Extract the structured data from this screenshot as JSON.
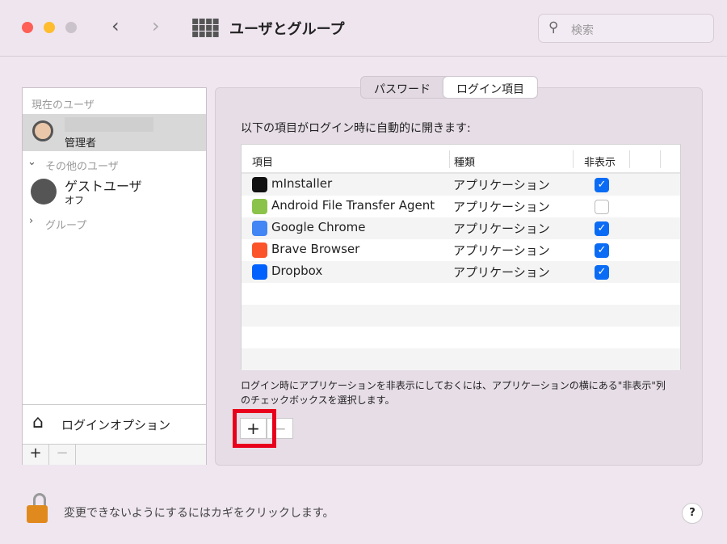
{
  "window": {
    "title": "ユーザとグループ",
    "search_placeholder": "検索"
  },
  "sidebar": {
    "current_header": "現在のユーザ",
    "current_user_role": "管理者",
    "others_header": "その他のユーザ",
    "guest_name": "ゲストユーザ",
    "guest_status": "オフ",
    "groups": "グループ",
    "login_options": "ログインオプション",
    "add": "+",
    "remove": "−"
  },
  "tabs": [
    "パスワード",
    "ログイン項目"
  ],
  "main": {
    "intro": "以下の項目がログイン時に自動的に開きます:",
    "columns": [
      "項目",
      "種類",
      "非表示"
    ],
    "items": [
      {
        "name": "mInstaller",
        "kind": "アプリケーション",
        "hidden": true,
        "icon": "minstaller-icon",
        "color": "#111111"
      },
      {
        "name": "Android File Transfer Agent",
        "kind": "アプリケーション",
        "hidden": false,
        "icon": "android-icon",
        "color": "#8bc34a"
      },
      {
        "name": "Google Chrome",
        "kind": "アプリケーション",
        "hidden": true,
        "icon": "chrome-icon",
        "color": "#4285f4"
      },
      {
        "name": "Brave Browser",
        "kind": "アプリケーション",
        "hidden": true,
        "icon": "brave-icon",
        "color": "#fb542b"
      },
      {
        "name": "Dropbox",
        "kind": "アプリケーション",
        "hidden": true,
        "icon": "dropbox-icon",
        "color": "#0061fe"
      }
    ],
    "hint": "ログイン時にアプリケーションを非表示にしておくには、アプリケーションの横にある\"非表示\"列のチェックボックスを選択します。",
    "add": "+",
    "remove": "−"
  },
  "footer": {
    "lock_text": "変更できないようにするにはカギをクリックします。",
    "help": "?"
  }
}
